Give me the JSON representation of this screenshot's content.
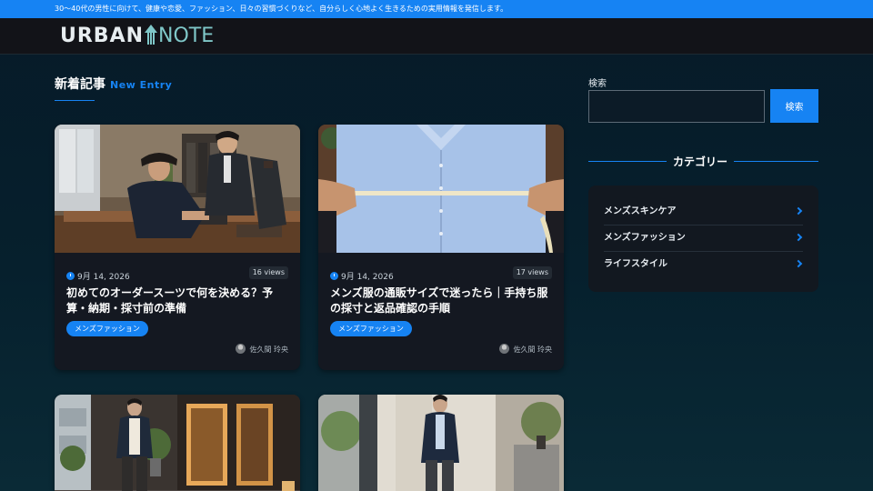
{
  "topbar": {
    "tagline": "30〜40代の男性に向けて、健康や恋愛、ファッション、日々の習慣づくりなど、自分らしく心地よく生きるための実用情報を発信します。"
  },
  "header": {
    "logo_part1": "URBAN",
    "logo_part2": "NOTE",
    "logo_icon": "upward-arrow-icon"
  },
  "main": {
    "section_title": "新着記事",
    "section_title_en": "New Entry",
    "articles": [
      {
        "image_alt": "テーラーでスーツを仕立てる男性",
        "date": "9月 14, 2026",
        "views": "16 views",
        "title": "初めてのオーダースーツで何を決める？予算・納期・採寸前の準備",
        "category": "メンズファッション",
        "author": "佐久間 玲央"
      },
      {
        "image_alt": "シャツの身幅をメジャーで採寸",
        "date": "9月 14, 2026",
        "views": "17 views",
        "title": "メンズ服の通販サイズで迷ったら｜手持ち服の採寸と返品確認の手順",
        "category": "メンズファッション",
        "author": "佐久間 玲央"
      },
      {
        "image_alt": "夜の街を歩く男性"
      },
      {
        "image_alt": "オフィスビルのロビーを歩く男性"
      }
    ]
  },
  "sidebar": {
    "search_label": "検索",
    "search_value": "",
    "search_button": "検索",
    "category_heading": "カテゴリー",
    "categories": [
      {
        "label": "メンズスキンケア"
      },
      {
        "label": "メンズファッション"
      },
      {
        "label": "ライフスタイル"
      }
    ]
  },
  "colors": {
    "accent": "#1683f3",
    "background": "#071a28",
    "card": "#141821",
    "header": "#121318"
  }
}
